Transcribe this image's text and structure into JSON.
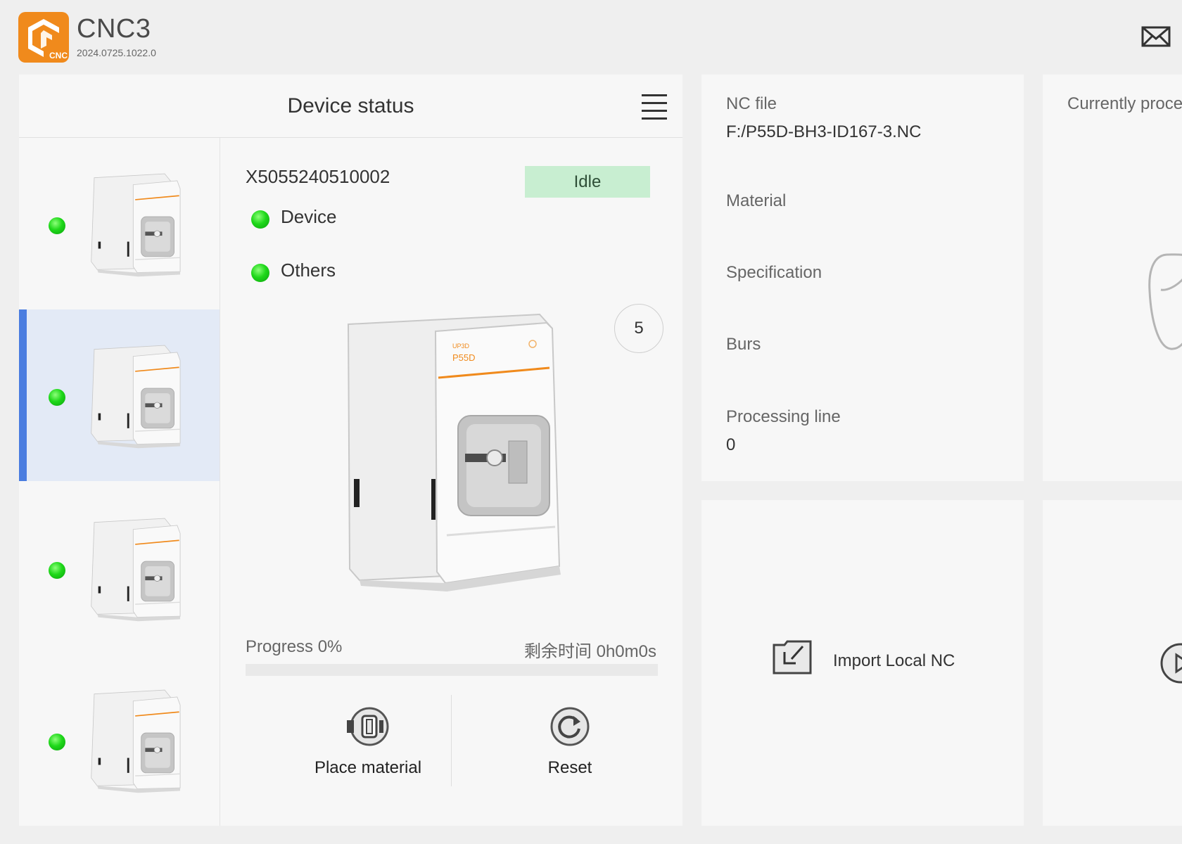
{
  "app": {
    "title": "CNC3",
    "version": "2024.0725.1022.0",
    "logo_text": "CNC",
    "brand_color": "#f08a1c"
  },
  "device_status": {
    "title": "Device status",
    "serial": "X5055240510002",
    "state": "Idle",
    "indicators": [
      {
        "label": "Device",
        "status": "ok"
      },
      {
        "label": "Others",
        "status": "ok"
      }
    ],
    "count": "5",
    "progress_label": "Progress 0%",
    "progress_fraction": 0,
    "remaining_time": "剩余时间 0h0m0s",
    "machine_brand": "UP3D",
    "machine_model": "P55D",
    "actions": {
      "place_material": "Place material",
      "reset": "Reset"
    },
    "device_list": [
      {
        "status": "ok",
        "selected": false
      },
      {
        "status": "ok",
        "selected": true
      },
      {
        "status": "ok",
        "selected": false
      },
      {
        "status": "ok",
        "selected": false
      }
    ]
  },
  "nc_info": {
    "nc_file_label": "NC file",
    "nc_file_value": "F:/P55D-BH3-ID167-3.NC",
    "material_label": "Material",
    "specification_label": "Specification",
    "burs_label": "Burs",
    "processing_line_label": "Processing line",
    "processing_line_value": "0"
  },
  "import": {
    "label": "Import Local NC"
  },
  "processing": {
    "title": "Currently processing"
  },
  "colors": {
    "accent_blue": "#4a7de0",
    "idle_badge": "#c8eed1",
    "status_green": "#1fd81a",
    "selected_bg": "#e3eaf6"
  }
}
